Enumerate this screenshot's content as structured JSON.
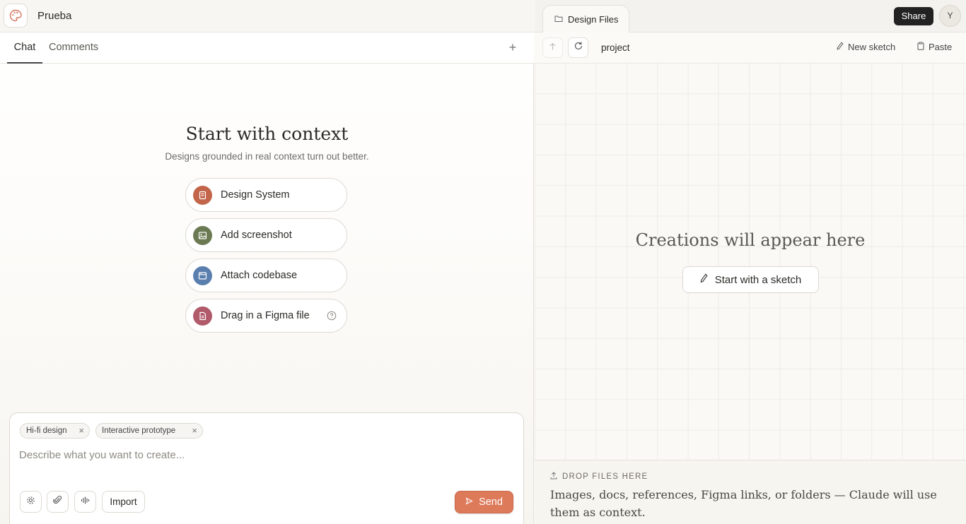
{
  "project": {
    "name": "Prueba"
  },
  "chat_tabs": [
    {
      "label": "Chat",
      "active": true
    },
    {
      "label": "Comments",
      "active": false
    }
  ],
  "empty_state": {
    "title": "Start with context",
    "subtitle": "Designs grounded in real context turn out better.",
    "options": [
      {
        "label": "Design System",
        "icon": "design-system-icon",
        "color": "#c2654a"
      },
      {
        "label": "Add screenshot",
        "icon": "image-icon",
        "color": "#6b7a52"
      },
      {
        "label": "Attach codebase",
        "icon": "codebase-icon",
        "color": "#5a7fae"
      },
      {
        "label": "Drag in a Figma file",
        "icon": "figma-file-icon",
        "color": "#b05a6a"
      }
    ]
  },
  "composer": {
    "chips": [
      {
        "label": "Hi-fi design"
      },
      {
        "label": "Interactive prototype"
      }
    ],
    "placeholder": "Describe what you want to create...",
    "import_label": "Import",
    "send_label": "Send",
    "accent": "#dd7a5a"
  },
  "files_panel": {
    "tab_label": "Design Files",
    "share_label": "Share",
    "avatar_initial": "Y",
    "path": "project",
    "new_sketch_label": "New sketch",
    "paste_label": "Paste",
    "empty_title": "Creations will appear here",
    "sketch_button_label": "Start with a sketch",
    "drop_label": "DROP FILES HERE",
    "drop_description": "Images, docs, references, Figma links, or folders — Claude will use them as context."
  }
}
